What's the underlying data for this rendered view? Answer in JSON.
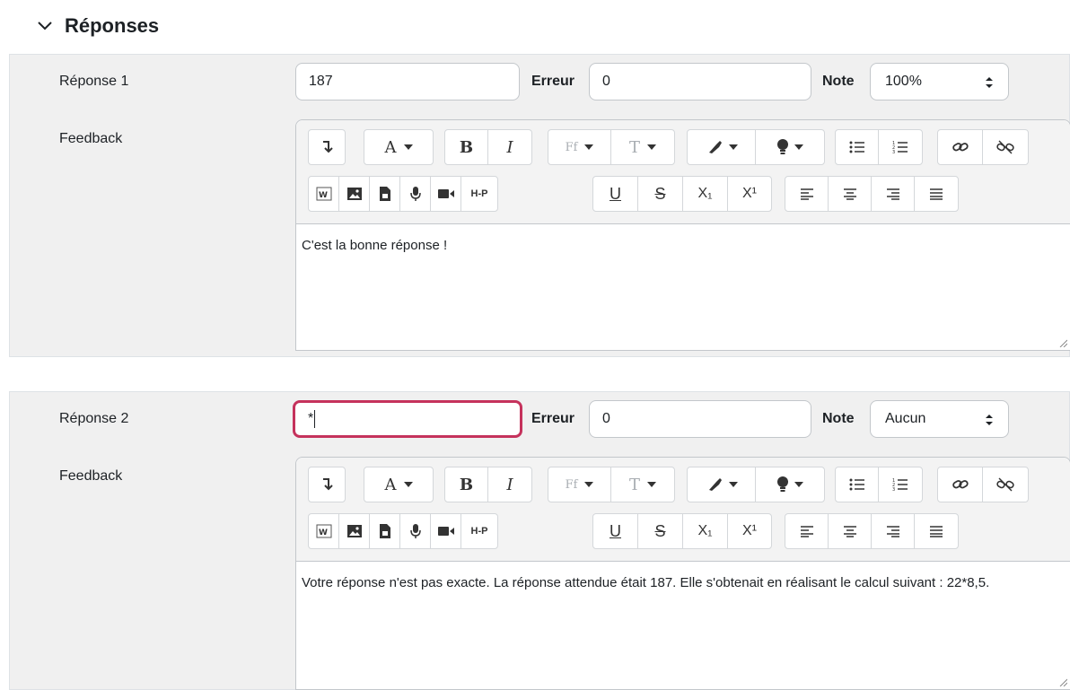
{
  "section": {
    "title": "Réponses",
    "icon": "chevron-down-icon"
  },
  "labels": {
    "erreur": "Erreur",
    "note": "Note",
    "feedback": "Feedback"
  },
  "toolbar": {
    "font_a": "A",
    "bold": "B",
    "italic": "I",
    "font_family": "Ff",
    "font_size": "T",
    "h5p": "H-P",
    "underline": "U",
    "strike": "S",
    "sub": "X₁",
    "sup": "X¹",
    "icons": [
      "show-more-icon",
      "font-color-icon",
      "bold-icon",
      "italic-icon",
      "font-family-icon",
      "font-size-icon",
      "brush-icon",
      "bulb-icon",
      "bullet-list-icon",
      "numbered-list-icon",
      "link-icon",
      "unlink-icon",
      "wiris-icon",
      "image-icon",
      "file-icon",
      "microphone-icon",
      "video-icon",
      "h5p-icon",
      "underline-icon",
      "strikethrough-icon",
      "subscript-icon",
      "superscript-icon",
      "align-left-icon",
      "align-center-icon",
      "align-right-icon",
      "align-justify-icon"
    ]
  },
  "answers": [
    {
      "label": "Réponse 1",
      "answer": "187",
      "erreur": "0",
      "note": "100%",
      "feedback": "C'est la bonne réponse !"
    },
    {
      "label": "Réponse 2",
      "answer": "*",
      "erreur": "0",
      "note": "Aucun",
      "feedback": "Votre réponse n'est pas exacte. La réponse attendue était 187. Elle s'obtenait en réalisant le calcul suivant : 22*8,5."
    }
  ],
  "colors": {
    "focus_border": "#c5325c",
    "panel_bg": "#f0f0f0"
  }
}
